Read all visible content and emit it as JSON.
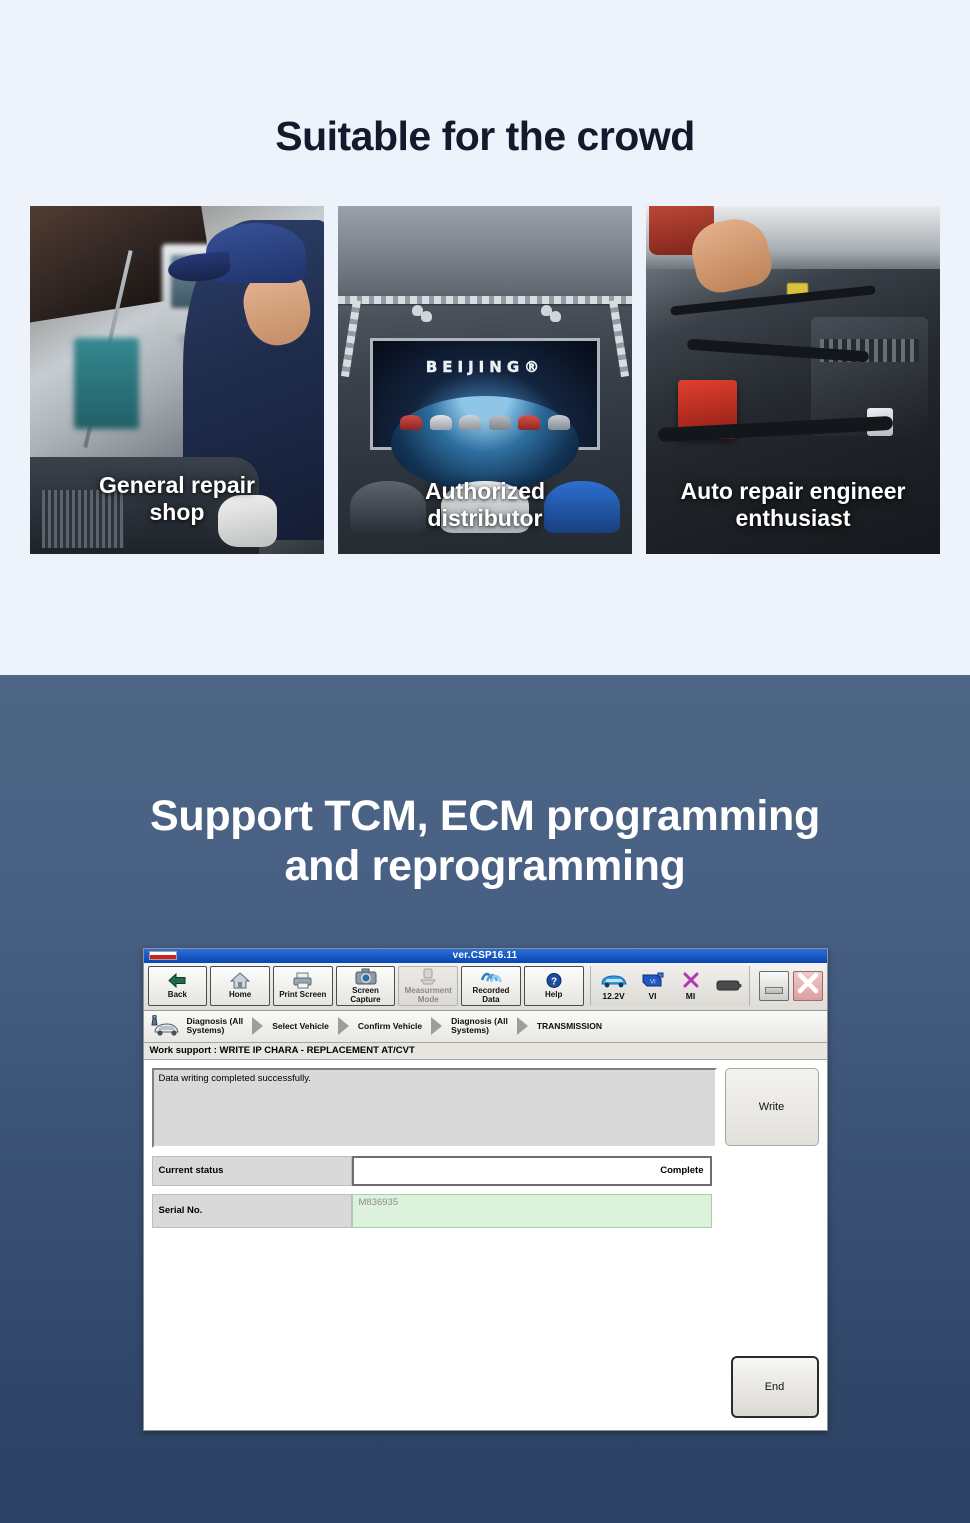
{
  "crowd": {
    "title": "Suitable for the crowd",
    "cards": [
      {
        "caption": "General repair\nshop",
        "image": "garage-mechanic-photo"
      },
      {
        "caption": "Authorized\ndistributor",
        "image": "beijing-showroom-photo",
        "brand": "BEIJING®"
      },
      {
        "caption": "Auto repair engineer\nenthusiast",
        "image": "engine-bay-photo"
      }
    ]
  },
  "tcm": {
    "title": "Support TCM, ECM programming\nand reprogramming"
  },
  "consult": {
    "titlebar": {
      "version": "ver.CSP16.11"
    },
    "toolbar": [
      {
        "label": "Back",
        "icon": "back-arrow-icon",
        "disabled": false
      },
      {
        "label": "Home",
        "icon": "home-icon",
        "disabled": false
      },
      {
        "label": "Print Screen",
        "icon": "printer-icon",
        "disabled": false
      },
      {
        "label": "Screen\nCapture",
        "icon": "camera-icon",
        "disabled": false
      },
      {
        "label": "Measurment\nMode",
        "icon": "measurement-icon",
        "disabled": true
      },
      {
        "label": "Recorded\nData",
        "icon": "recorded-data-icon",
        "disabled": false
      },
      {
        "label": "Help",
        "icon": "help-question-icon",
        "disabled": false
      }
    ],
    "status": [
      {
        "label": "12.2V",
        "icon": "car-battery-voltage-icon"
      },
      {
        "label": "VI",
        "icon": "vehicle-interface-icon"
      },
      {
        "label": "MI",
        "icon": "measurement-interface-x-icon"
      },
      {
        "label": "",
        "icon": "battery-icon"
      }
    ],
    "window_controls": {
      "minimize": "minimize-icon",
      "close": "close-x-icon"
    },
    "breadcrumb": [
      "Diagnosis (All\nSystems)",
      "Select Vehicle",
      "Confirm Vehicle",
      "Diagnosis (All\nSystems)",
      "TRANSMISSION"
    ],
    "work_support": "Work support : WRITE IP CHARA - REPLACEMENT AT/CVT",
    "message": "Data writing completed successfully.",
    "write_button": "Write",
    "fields": [
      {
        "label": "Current status",
        "value": "Complete"
      },
      {
        "label": "Serial No.",
        "value": "M836935"
      }
    ],
    "end_button": "End"
  },
  "colors": {
    "page_bg": "#eef3fb",
    "heading": "#121a2b",
    "tcm_top": "#4e6685",
    "tcm_bottom": "#2d4265",
    "titlebar_blue": "#0a44b0",
    "serial_field_bg": "#ddf2dd",
    "close_red": "#cc3b3b"
  }
}
